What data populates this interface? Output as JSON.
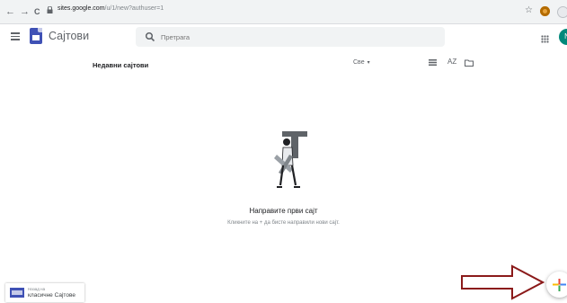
{
  "browser": {
    "url_host": "sites.google.com",
    "url_path": "/u/1/new?authuser=1",
    "back_glyph": "←",
    "forward_glyph": "→",
    "reload_glyph": "C",
    "star_glyph": "☆"
  },
  "appbar": {
    "title": "Сајтови",
    "search_placeholder": "Претрага",
    "avatar_letter": "N"
  },
  "list_header": {
    "recent_label": "Недавни сајтови",
    "owner_filter": "Све",
    "owner_caret": "▾",
    "sort_label": "AZ"
  },
  "empty_state": {
    "title": "Направите први сајт",
    "subtitle": "Кликните на + да бисте направили нови сајт."
  },
  "classic_sites": {
    "line1": "Назад на",
    "line2": "класичне Сајтове"
  },
  "colors": {
    "sites_blue": "#3f51b5",
    "arrow_red": "#8b1a1a",
    "avatar_teal": "#00897b"
  },
  "icons": [
    "back-icon",
    "forward-icon",
    "reload-icon",
    "lock-icon",
    "star-icon",
    "extension-icon",
    "menu-icon",
    "sites-logo-icon",
    "search-icon",
    "apps-grid-icon",
    "list-view-icon",
    "sort-az-icon",
    "folder-icon",
    "plus-icon",
    "red-arrow-icon"
  ]
}
